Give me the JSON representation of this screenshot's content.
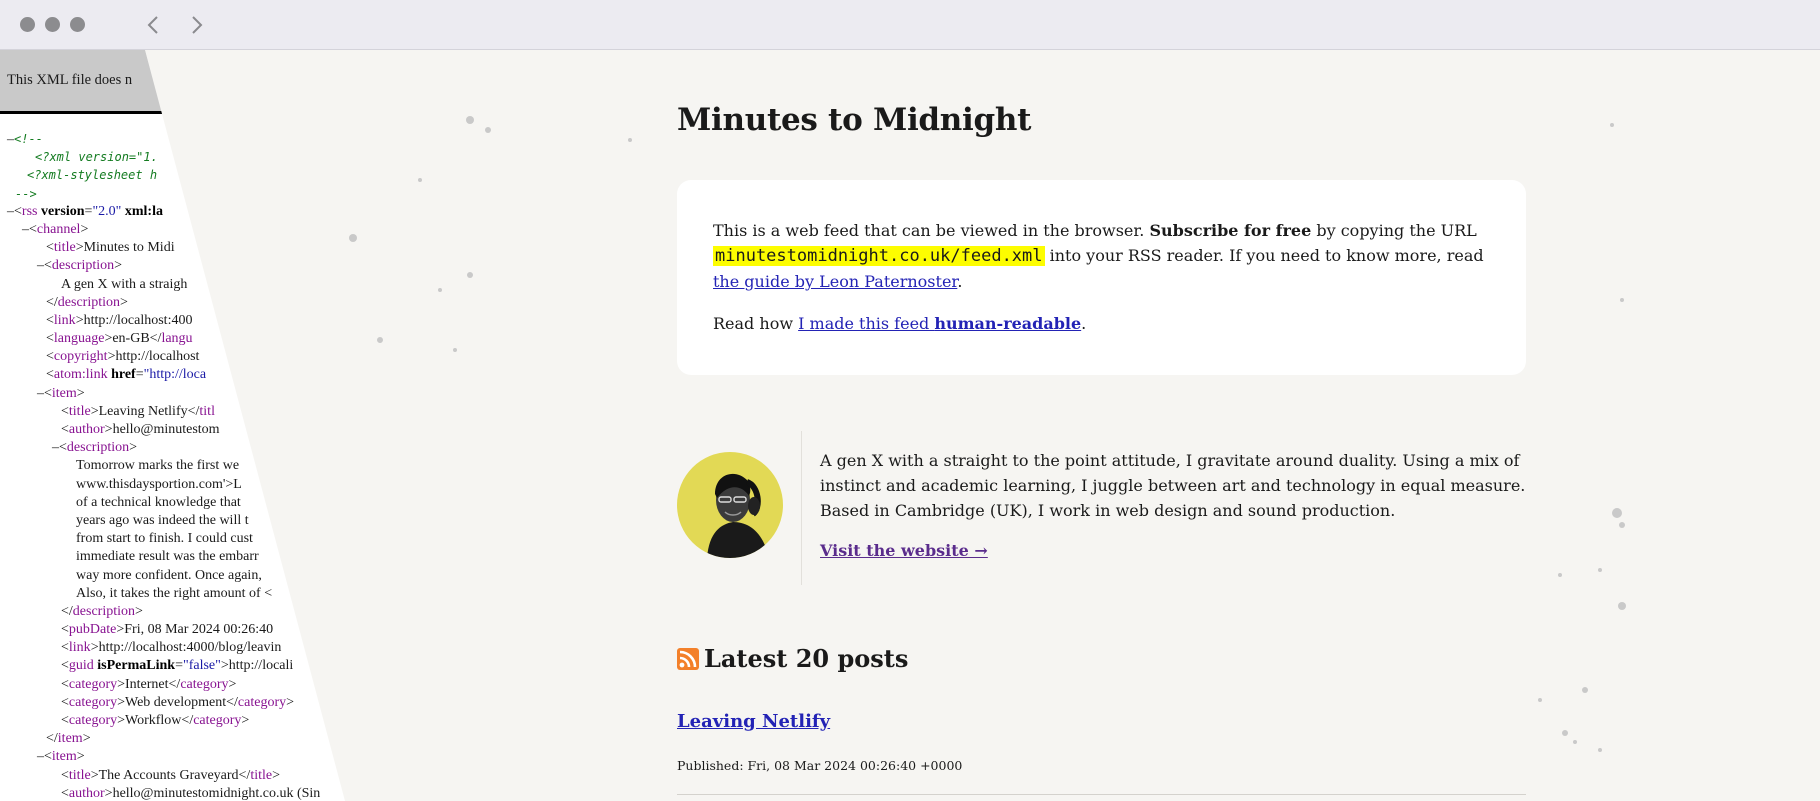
{
  "browser": {
    "back_icon": "chevron-left-icon",
    "forward_icon": "chevron-right-icon"
  },
  "raw_xml": {
    "notice": "This XML file does n",
    "lines": [
      {
        "indent": 7,
        "html": "<span class=\"b\">–</span><span class=\"cm\">&lt;!--</span>"
      },
      {
        "indent": 35,
        "html": "<span class=\"cm\">&lt;?xml version=\"1.</span>"
      },
      {
        "indent": 27,
        "html": "<span class=\"cm\">&lt;?xml-stylesheet h</span>"
      },
      {
        "indent": 15,
        "html": "<span class=\"cm\">--&gt;</span>"
      },
      {
        "indent": 7,
        "html": "–&lt;<span class=\"tg\">rss</span> <span class=\"at\">version</span>=<span class=\"av\">\"2.0\"</span> <span class=\"at\">xml:la</span>"
      },
      {
        "indent": 22,
        "html": "–&lt;<span class=\"tg\">channel</span>&gt;"
      },
      {
        "indent": 46,
        "html": "&lt;<span class=\"tg\">title</span>&gt;Minutes to Midi"
      },
      {
        "indent": 37,
        "html": "–&lt;<span class=\"tg\">description</span>&gt;"
      },
      {
        "indent": 61,
        "html": "A gen X with a straigh"
      },
      {
        "indent": 46,
        "html": "&lt;/<span class=\"tg\">description</span>&gt;"
      },
      {
        "indent": 46,
        "html": "&lt;<span class=\"tg\">link</span>&gt;http://localhost:400"
      },
      {
        "indent": 46,
        "html": "&lt;<span class=\"tg\">language</span>&gt;en-GB&lt;/<span class=\"tg\">langu</span>"
      },
      {
        "indent": 46,
        "html": "&lt;<span class=\"tg\">copyright</span>&gt;http://localhost"
      },
      {
        "indent": 46,
        "html": "&lt;<span class=\"tg\">atom:link</span> <span class=\"at\">href</span>=<span class=\"av\">\"http://loca</span>"
      },
      {
        "indent": 37,
        "html": "–&lt;<span class=\"tg\">item</span>&gt;"
      },
      {
        "indent": 61,
        "html": "&lt;<span class=\"tg\">title</span>&gt;Leaving Netlify&lt;/<span class=\"tg\">titl</span>"
      },
      {
        "indent": 61,
        "html": "&lt;<span class=\"tg\">author</span>&gt;hello@minutestom"
      },
      {
        "indent": 52,
        "html": "–&lt;<span class=\"tg\">description</span>&gt;"
      },
      {
        "indent": 76,
        "html": "Tomorrow marks the first we"
      },
      {
        "indent": 76,
        "html": "www.thisdaysportion.com'&gt;L"
      },
      {
        "indent": 76,
        "html": "of a technical knowledge that"
      },
      {
        "indent": 76,
        "html": "years ago was indeed the will t"
      },
      {
        "indent": 76,
        "html": "from start to finish. I could cust"
      },
      {
        "indent": 76,
        "html": "immediate result was the embarr"
      },
      {
        "indent": 76,
        "html": "way more confident. Once again,"
      },
      {
        "indent": 76,
        "html": "Also, it takes the right amount of &lt;"
      },
      {
        "indent": 61,
        "html": "&lt;/<span class=\"tg\">description</span>&gt;"
      },
      {
        "indent": 61,
        "html": "&lt;<span class=\"tg\">pubDate</span>&gt;Fri, 08 Mar 2024 00:26:40"
      },
      {
        "indent": 61,
        "html": "&lt;<span class=\"tg\">link</span>&gt;http://localhost:4000/blog/leavin"
      },
      {
        "indent": 61,
        "html": "&lt;<span class=\"tg\">guid</span> <span class=\"at\">isPermaLink</span>=<span class=\"av\">\"false\"</span>&gt;http://locali"
      },
      {
        "indent": 61,
        "html": "&lt;<span class=\"tg\">category</span>&gt;Internet&lt;/<span class=\"tg\">category</span>&gt;"
      },
      {
        "indent": 61,
        "html": "&lt;<span class=\"tg\">category</span>&gt;Web development&lt;/<span class=\"tg\">category</span>&gt;"
      },
      {
        "indent": 61,
        "html": "&lt;<span class=\"tg\">category</span>&gt;Workflow&lt;/<span class=\"tg\">category</span>&gt;"
      },
      {
        "indent": 46,
        "html": "&lt;/<span class=\"tg\">item</span>&gt;"
      },
      {
        "indent": 37,
        "html": "–&lt;<span class=\"tg\">item</span>&gt;"
      },
      {
        "indent": 61,
        "html": "&lt;<span class=\"tg\">title</span>&gt;The Accounts Graveyard&lt;/<span class=\"tg\">title</span>&gt;"
      },
      {
        "indent": 61,
        "html": "&lt;<span class=\"tg\">author</span>&gt;hello@minutestomidnight.co.uk (Sin"
      }
    ]
  },
  "feed": {
    "title": "Minutes to Midnight",
    "intro_part1": "This is a web feed that can be viewed in the browser. ",
    "intro_strong": "Subscribe for free",
    "intro_part2": " by copying the URL ",
    "feed_url": "minutestomidnight.co.uk/feed.xml",
    "intro_part3": " into your RSS reader. If you need to know more, read ",
    "guide_link": "the guide by Leon Paternoster",
    "intro_end": ".",
    "readhow_prefix": "Read how ",
    "readhow_link": "I made this feed ",
    "readhow_link_strong": "human-readable",
    "readhow_end": "."
  },
  "author": {
    "bio": "A gen X with a straight to the point attitude, I gravitate around duality. Using a mix of instinct and academic learning, I juggle between art and technology in equal measure. Based in Cambridge (UK), I work in web design and sound production.",
    "visit_label": "Visit the website →",
    "avatar_icon": "author-portrait"
  },
  "posts": {
    "icon": "rss-icon",
    "heading": "Latest 20 posts",
    "items": [
      {
        "title": "Leaving Netlify",
        "published": "Published: Fri, 08 Mar 2024 00:26:40 +0000"
      }
    ]
  },
  "colors": {
    "background": "#f6f5f2",
    "card": "#ffffff",
    "link": "#2323b5",
    "visited_link": "#5a2c8c",
    "highlight": "#fdfd00",
    "rss": "#f3802a",
    "avatar_bg": "#e2d955",
    "xml_tag": "#881391",
    "xml_comment": "#137b20",
    "xml_value": "#1a1aa6"
  }
}
